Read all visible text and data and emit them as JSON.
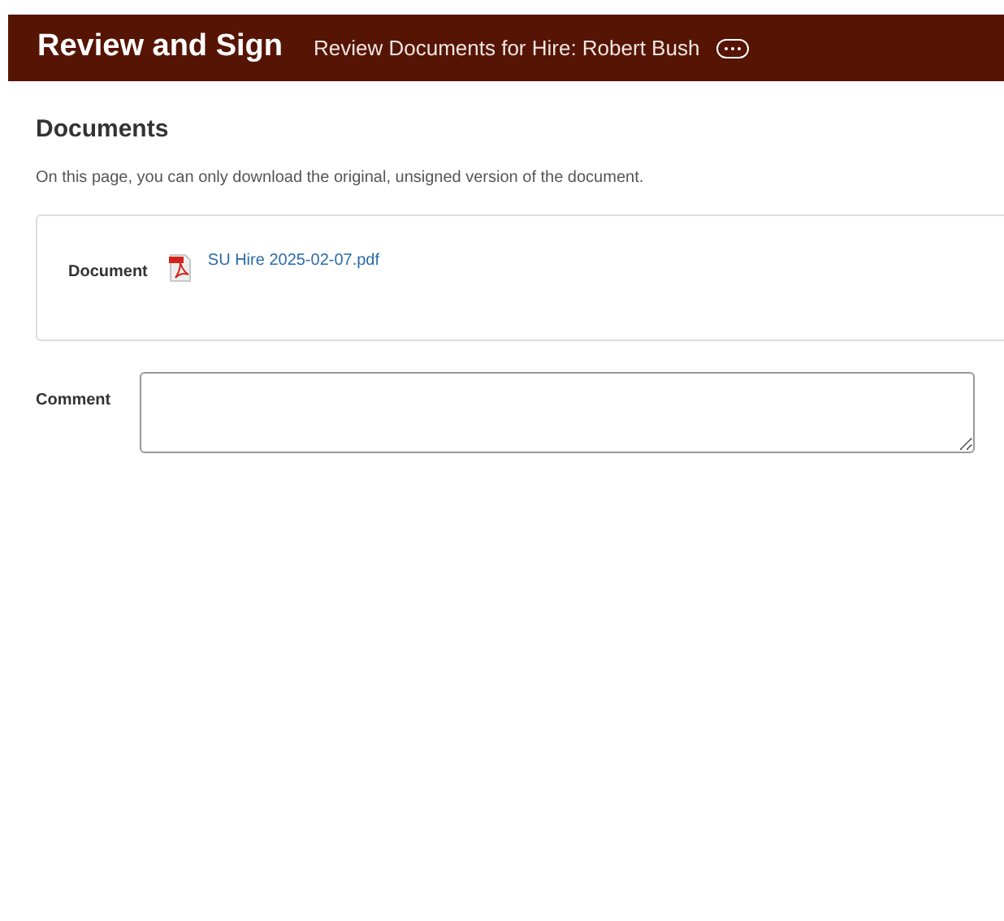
{
  "header": {
    "title": "Review and Sign",
    "subtitle": "Review Documents for Hire: Robert Bush"
  },
  "section": {
    "title": "Documents",
    "note": "On this page, you can only download the original, unsigned version of the document."
  },
  "document": {
    "label": "Document",
    "file": "SU Hire 2025-02-07.pdf"
  },
  "comment": {
    "label": "Comment"
  }
}
